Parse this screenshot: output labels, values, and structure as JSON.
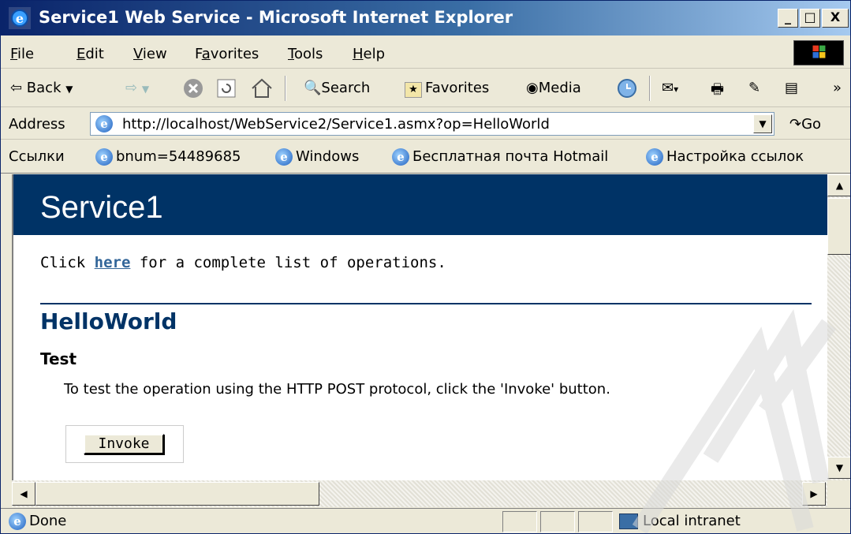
{
  "window": {
    "title": "Service1 Web Service - Microsoft Internet Explorer",
    "controls": [
      "_",
      "□",
      "X"
    ]
  },
  "menu": {
    "items": [
      {
        "label": "File",
        "accel": "F",
        "rest": "ile"
      },
      {
        "label": "Edit",
        "accel": "E",
        "rest": "dit"
      },
      {
        "label": "View",
        "accel": "V",
        "rest": "iew"
      },
      {
        "label": "Favorites",
        "accel": "a",
        "pre": "F",
        "rest": "vorites"
      },
      {
        "label": "Tools",
        "accel": "T",
        "rest": "ools"
      },
      {
        "label": "Help",
        "accel": "H",
        "rest": "elp"
      }
    ]
  },
  "toolbar": {
    "back": "⇦ Back",
    "forward": "⇨",
    "search": "Search",
    "favorites": "Favorites",
    "media": "Media",
    "more": "»"
  },
  "address": {
    "label": "Address",
    "url": "http://localhost/WebService2/Service1.asmx?op=HelloWorld",
    "go": "Go"
  },
  "links": {
    "label": "Ссылки",
    "items": [
      "bnum=54489685",
      "Windows",
      "Бесплатная почта Hotmail",
      "Настройка ссылок"
    ]
  },
  "page": {
    "service_name": "Service1",
    "intro_before": "Click ",
    "intro_link": "here",
    "intro_after": " for a complete list of operations.",
    "operation": "HelloWorld",
    "test_heading": "Test",
    "test_description": "To test the operation using the HTTP POST protocol, click the 'Invoke' button.",
    "invoke_label": "Invoke"
  },
  "status": {
    "text": "Done",
    "zone": "Local intranet"
  },
  "colors": {
    "banner": "#003366",
    "link": "#336699",
    "chrome": "#ECE9D8"
  }
}
